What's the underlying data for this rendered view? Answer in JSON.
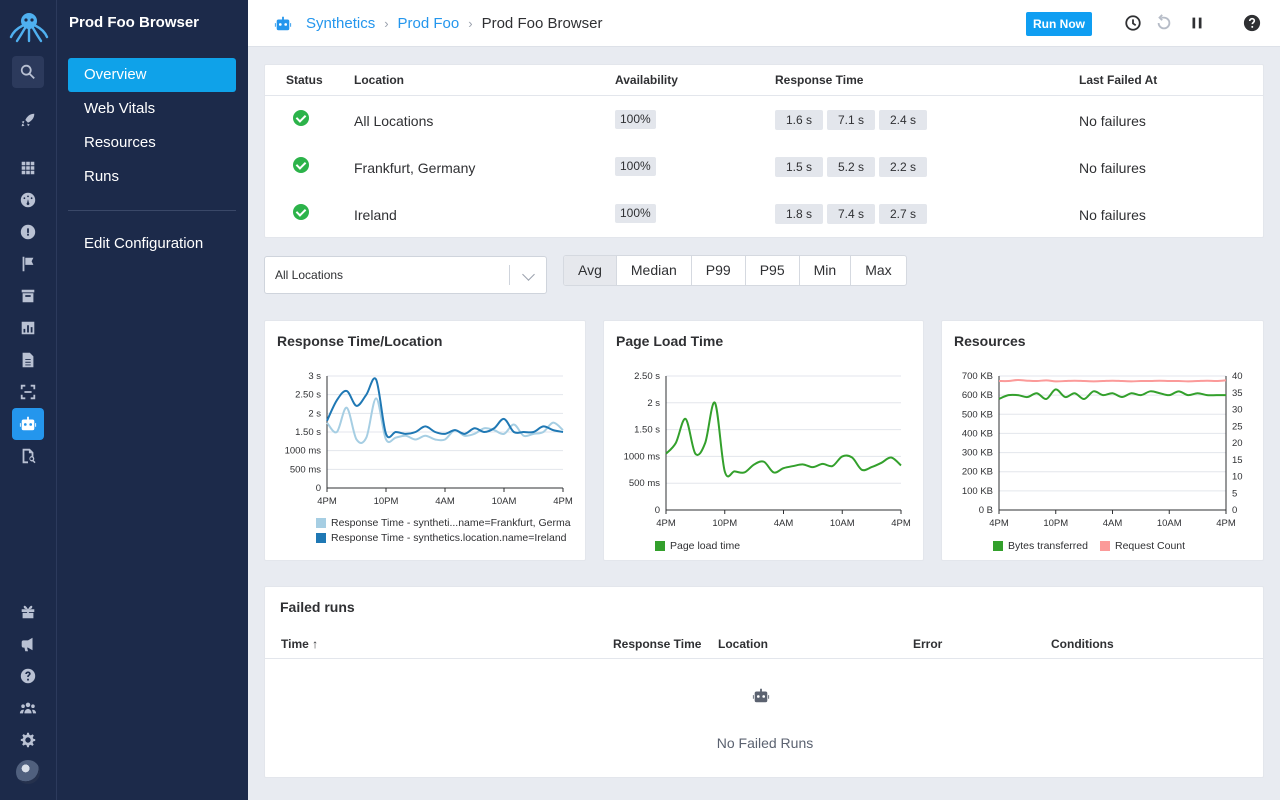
{
  "app": {
    "section_title": "Prod Foo Browser"
  },
  "subnav": {
    "items": [
      "Overview",
      "Web Vitals",
      "Resources",
      "Runs"
    ],
    "config": "Edit Configuration"
  },
  "header": {
    "breadcrumb": [
      "Synthetics",
      "Prod Foo",
      "Prod Foo Browser"
    ],
    "run_now": "Run Now"
  },
  "locations_table": {
    "headers": [
      "Status",
      "Location",
      "Availability",
      "Response Time",
      "Last Failed At"
    ],
    "rows": [
      {
        "status": "ok",
        "location": "All Locations",
        "availability": "100%",
        "response_times": [
          "1.6 s",
          "7.1 s",
          "2.4 s"
        ],
        "last_failed": "No failures"
      },
      {
        "status": "ok",
        "location": "Frankfurt, Germany",
        "availability": "100%",
        "response_times": [
          "1.5 s",
          "5.2 s",
          "2.2 s"
        ],
        "last_failed": "No failures"
      },
      {
        "status": "ok",
        "location": "Ireland",
        "availability": "100%",
        "response_times": [
          "1.8 s",
          "7.4 s",
          "2.7 s"
        ],
        "last_failed": "No failures"
      }
    ]
  },
  "filter": {
    "location_select": "All Locations",
    "aggregations": [
      "Avg",
      "Median",
      "P99",
      "P95",
      "Min",
      "Max"
    ],
    "active_aggregation": "Avg"
  },
  "chart_data": [
    {
      "type": "line",
      "title": "Response Time/Location",
      "x": [
        "4PM",
        "",
        "",
        "",
        "",
        "",
        "10PM",
        "",
        "",
        "",
        "",
        "",
        "4AM",
        "",
        "",
        "",
        "",
        "",
        "10AM",
        "",
        "",
        "",
        "",
        "",
        "4PM"
      ],
      "xticks": [
        "4PM",
        "10PM",
        "4AM",
        "10AM",
        "4PM"
      ],
      "yticks": [
        "0",
        "500 ms",
        "1000 ms",
        "1.50 s",
        "2 s",
        "2.50 s",
        "3 s"
      ],
      "ylim": [
        0,
        3000
      ],
      "series": [
        {
          "name": "Response Time - syntheti...name=Frankfurt, Germa",
          "color": "#a6cee3",
          "values": [
            1750,
            1500,
            2150,
            1300,
            1350,
            2400,
            1300,
            1350,
            1400,
            1300,
            1400,
            1300,
            1300,
            1550,
            1400,
            1450,
            1600,
            1550,
            1450,
            1700,
            1400,
            1450,
            1500,
            1750,
            1550
          ]
        },
        {
          "name": "Response Time - synthetics.location.name=Ireland",
          "color": "#1f78b4",
          "values": [
            1800,
            2350,
            2600,
            2200,
            2500,
            2900,
            1450,
            1500,
            1450,
            1500,
            1650,
            1500,
            1450,
            1550,
            1450,
            1600,
            1500,
            1600,
            1850,
            1500,
            1500,
            1500,
            1650,
            1550,
            1500
          ]
        }
      ]
    },
    {
      "type": "line",
      "title": "Page Load Time",
      "xticks": [
        "4PM",
        "10PM",
        "4AM",
        "10AM",
        "4PM"
      ],
      "yticks": [
        "0",
        "500 ms",
        "1000 ms",
        "1.50 s",
        "2 s",
        "2.50 s"
      ],
      "ylim": [
        0,
        2500
      ],
      "series": [
        {
          "name": "Page load time",
          "color": "#33a02c",
          "values": [
            1050,
            1250,
            1700,
            1050,
            1250,
            2000,
            720,
            720,
            700,
            850,
            900,
            700,
            780,
            820,
            850,
            800,
            860,
            820,
            1000,
            980,
            750,
            800,
            880,
            980,
            830
          ]
        }
      ]
    },
    {
      "type": "line",
      "title": "Resources",
      "xticks": [
        "4PM",
        "10PM",
        "4AM",
        "10AM",
        "4PM"
      ],
      "yticks_left": [
        "0 B",
        "100 KB",
        "200 KB",
        "300 KB",
        "400 KB",
        "500 KB",
        "600 KB",
        "700 KB"
      ],
      "yticks_right": [
        "0",
        "5",
        "10",
        "15",
        "20",
        "25",
        "30",
        "35",
        "40"
      ],
      "ylim_left": [
        0,
        700
      ],
      "ylim_right": [
        0,
        40
      ],
      "series": [
        {
          "name": "Bytes transferred",
          "color": "#33a02c",
          "axis": "left",
          "values": [
            580,
            600,
            600,
            590,
            610,
            580,
            630,
            590,
            610,
            580,
            620,
            600,
            610,
            590,
            610,
            600,
            620,
            610,
            600,
            620,
            600,
            610,
            600,
            600,
            600
          ]
        },
        {
          "name": "Request Count",
          "color": "#fb9a99",
          "axis": "right",
          "values": [
            38.5,
            38.5,
            38.8,
            38.6,
            38.5,
            38.7,
            38.4,
            38.5,
            38.6,
            38.5,
            38.4,
            38.5,
            38.6,
            38.5,
            38.4,
            38.5,
            38.5,
            38.6,
            38.5,
            38.5,
            38.4,
            38.5,
            38.6,
            38.5,
            38.7
          ]
        }
      ]
    }
  ],
  "failed_runs": {
    "title": "Failed runs",
    "columns": [
      "Time",
      "Response Time",
      "Location",
      "Error",
      "Conditions"
    ],
    "sort_icon": "arrow-up-icon",
    "empty": "No Failed Runs"
  }
}
